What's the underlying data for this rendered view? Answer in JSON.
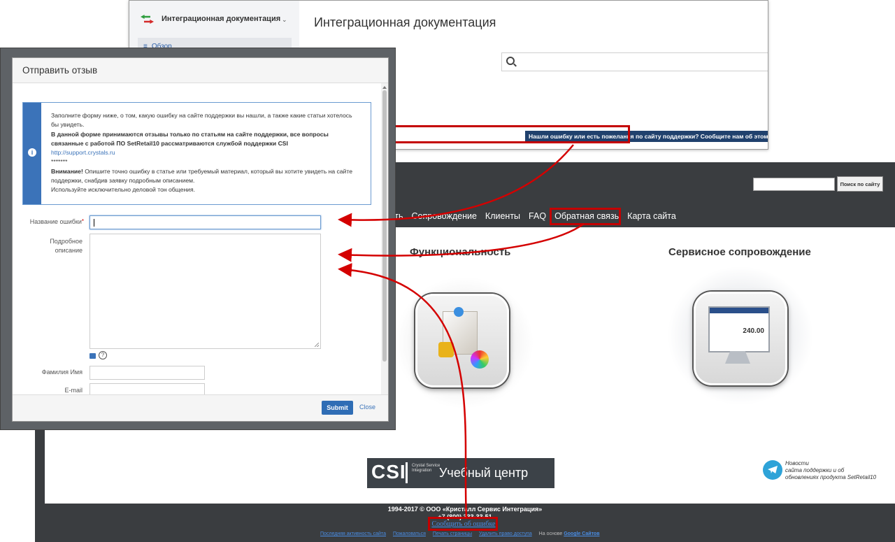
{
  "docs": {
    "brand": "Интеграционная документация",
    "nav_overview": "Обзор",
    "title": "Интеграционная документация",
    "search_placeholder": "",
    "feedback_link": "Нашли ошибку или есть пожелания по сайту поддержки? Сообщите нам об этом."
  },
  "modal": {
    "title": "Отправить отзыв",
    "info": {
      "line1": "Заполните форму ниже, о том, какую ошибку на сайте поддержки вы нашли, а также какие статьи хотелось бы увидеть.",
      "line2": "В данной форме принимаются отзывы только по статьям на сайте поддержки, все вопросы связанные с работой ПО SetRetail10 рассматриваются службой поддержки CSI",
      "link": "http://support.crystals.ru",
      "stars": "*******",
      "warn_label": "Внимание!",
      "warn_text": " Опишите точно ошибку в статье или требуемый материал, который вы хотите увидеть на сайте поддержки, снабдив заявку подробным описанием.",
      "line4": "Используйте исключительно деловой тон общения."
    },
    "fields": {
      "error_name_label": "Название ошибки",
      "error_name_value": "",
      "description_label": "Подробное описание",
      "fullname_label": "Фамилия Имя",
      "email_label": "E-mail"
    },
    "submit": "Submit",
    "close": "Close"
  },
  "site": {
    "search_button": "Поиск по сайту",
    "nav": [
      "сть",
      "Сопровождение",
      "Клиенты",
      "FAQ",
      "Обратная связь",
      "Карта сайта"
    ],
    "section1": "Функциональность",
    "section2": "Сервисное сопровождение",
    "receipt_total": "240.00",
    "csi_logo": "CSI",
    "csi_sub": "Crystal Service Integration",
    "training": "Учебный центр",
    "telegram_text": [
      "Новости",
      "сайта поддержки и об",
      "обновлениях продукта SetRetail10"
    ],
    "footer_copy": "1994-2017 © ООО «Кристалл Сервис Интеграция»",
    "footer_phone": "+7 (800) 333-33-51",
    "report_link": "Сообщить об ошибке",
    "footer_links": [
      "Последняя активность сайта",
      "Пожаловаться",
      "Печать страницы",
      "Удалить право доступа"
    ],
    "footer_based": "На основе",
    "footer_google": "Google Сайтов"
  },
  "colors": {
    "accent_red": "#c40000",
    "link_blue": "#3b73b9",
    "docs_button": "#20416d"
  }
}
